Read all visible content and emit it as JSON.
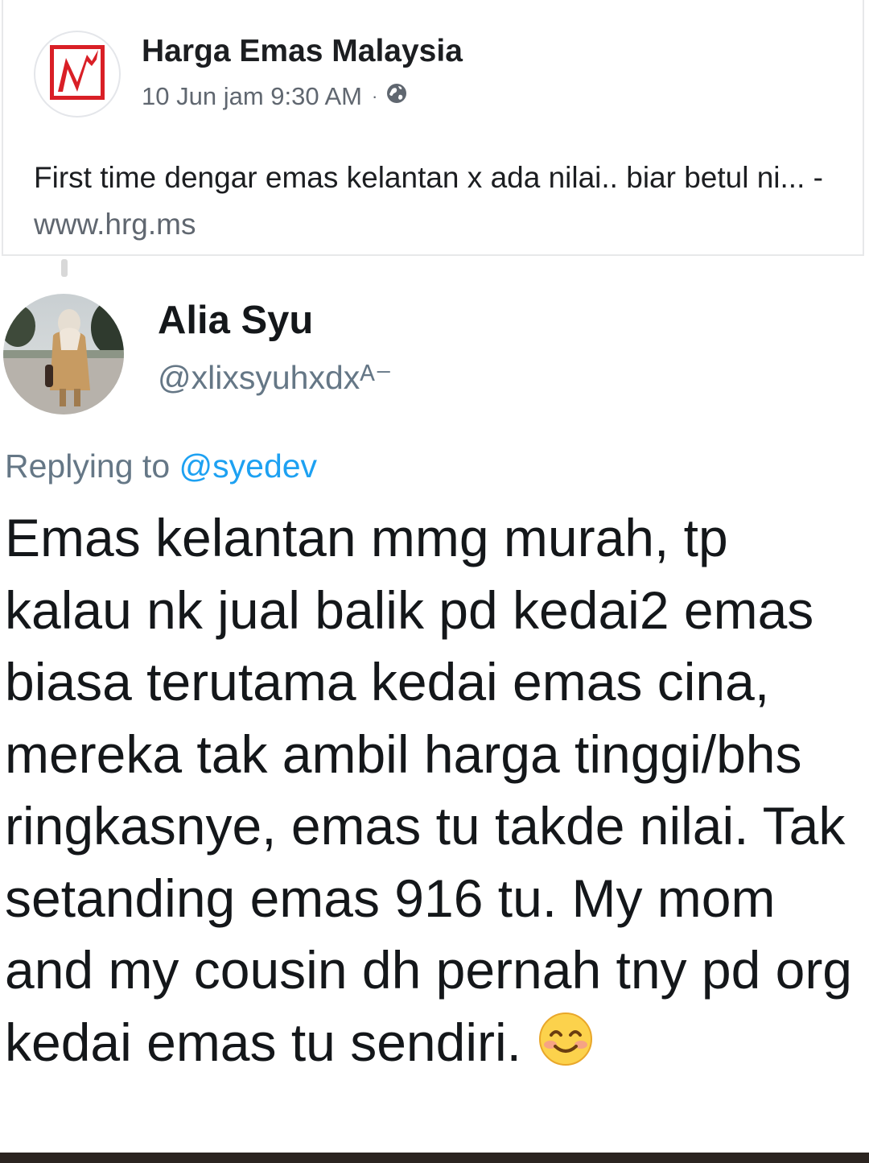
{
  "facebook_post": {
    "page_name": "Harga Emas Malaysia",
    "timestamp": "10 Jun jam 9:30 AM",
    "separator": "·",
    "audience_icon": "globe-icon",
    "logo_icon": "harga-emas-logo-icon",
    "text": "First time dengar emas kelantan x ada nilai.. biar betul ni...",
    "link_prefix": " - ",
    "link": "www.hrg.ms"
  },
  "tweet": {
    "display_name": "Alia Syu",
    "handle": "@xlixsyuhxdx",
    "handle_trailing": "ᴬ⁻",
    "replying_prefix": "Replying to ",
    "replying_to": "@syedev",
    "body": "Emas kelantan mmg murah, tp kalau nk jual balik pd kedai2 emas biasa terutama kedai emas cina, mereka tak ambil harga tinggi/bhs ringkasnye, emas tu takde nilai. Tak setanding emas 916 tu. My mom and my cousin dh pernah tny pd org kedai emas tu sendiri.",
    "emoji_icon": "smiling-face-icon"
  },
  "colors": {
    "facebook_text": "#1c1e21",
    "facebook_meta": "#606770",
    "twitter_text": "#14171a",
    "twitter_meta": "#657786",
    "twitter_mention": "#1da1f2",
    "logo_red": "#d91f26"
  }
}
